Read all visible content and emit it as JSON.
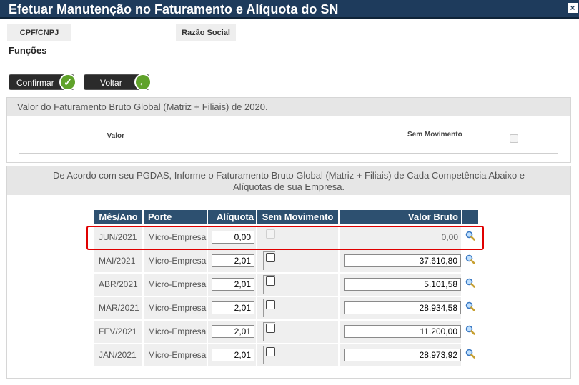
{
  "window": {
    "title": "Efetuar Manutenção no Faturamento e Alíquota do SN"
  },
  "tabs": [
    {
      "label": "CPF/CNPJ"
    },
    {
      "label": "Razão Social"
    }
  ],
  "section": {
    "funcoes": "Funções"
  },
  "buttons": {
    "confirm": "Confirmar",
    "back": "Voltar"
  },
  "panel1": {
    "heading": "Valor do Faturamento Bruto Global (Matriz + Filiais) de 2020.",
    "valor_label": "Valor",
    "sem_movimento_label": "Sem Movimento"
  },
  "panel2": {
    "heading_line1": "De Acordo com seu PGDAS, Informe o Faturamento Bruto Global (Matriz + Filiais) de Cada Competência Abaixo e",
    "heading_line2": "Alíquotas de sua Empresa."
  },
  "grid": {
    "headers": {
      "mes": "Mês/Ano",
      "porte": "Porte",
      "aliquota": "Alíquota",
      "sem": "Sem Movimento",
      "valor": "Valor Bruto"
    },
    "rows": [
      {
        "mes": "JUN/2021",
        "porte": "Micro-Empresa",
        "aliquota": "0,00",
        "valor": "0,00",
        "sem_movimento": false,
        "editable": false
      },
      {
        "mes": "MAI/2021",
        "porte": "Micro-Empresa",
        "aliquota": "2,01",
        "valor": "37.610,80",
        "sem_movimento": false,
        "editable": true
      },
      {
        "mes": "ABR/2021",
        "porte": "Micro-Empresa",
        "aliquota": "2,01",
        "valor": "5.101,58",
        "sem_movimento": false,
        "editable": true
      },
      {
        "mes": "MAR/2021",
        "porte": "Micro-Empresa",
        "aliquota": "2,01",
        "valor": "28.934,58",
        "sem_movimento": false,
        "editable": true
      },
      {
        "mes": "FEV/2021",
        "porte": "Micro-Empresa",
        "aliquota": "2,01",
        "valor": "11.200,00",
        "sem_movimento": false,
        "editable": true
      },
      {
        "mes": "JAN/2021",
        "porte": "Micro-Empresa",
        "aliquota": "2,01",
        "valor": "28.973,92",
        "sem_movimento": false,
        "editable": true
      }
    ]
  },
  "colors": {
    "titlebar": "#1e3b5c",
    "grid_header": "#2d5070",
    "highlight": "#e00000"
  }
}
